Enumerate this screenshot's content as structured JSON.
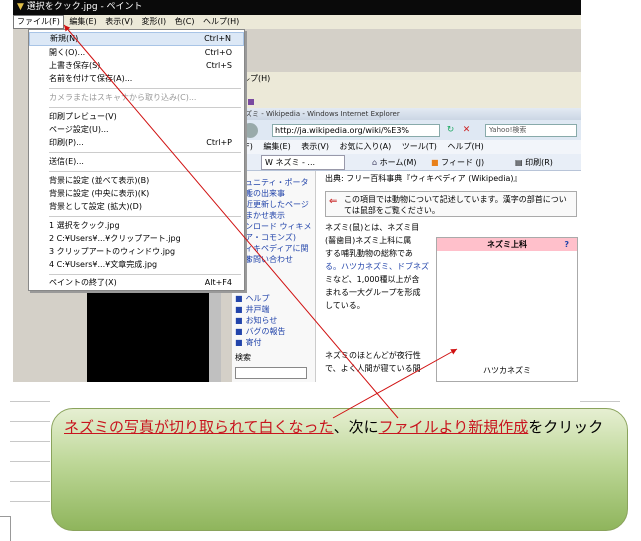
{
  "paint": {
    "title": "選択をクック.jpg - ペイント",
    "menu": [
      "ファイル(F)",
      "編集(E)",
      "表示(V)",
      "変形(I)",
      "色(C)",
      "ヘルプ(H)"
    ]
  },
  "background_window": {
    "menu_fragment": "ヘルプ(H)",
    "palette_colors": [
      "#6b2f8a",
      "#2c5ca8",
      "#7a4aa0",
      "#c8c8c8"
    ]
  },
  "file_menu": {
    "items": [
      {
        "label": "新規(N)",
        "shortcut": "Ctrl+N",
        "highlighted": true
      },
      {
        "label": "開く(O)...",
        "shortcut": "Ctrl+O"
      },
      {
        "label": "上書き保存(S)",
        "shortcut": "Ctrl+S"
      },
      {
        "label": "名前を付けて保存(A)..."
      },
      {
        "label": "カメラまたはスキャナから取り込み(C)...",
        "disabled": true
      },
      {
        "label": "印刷プレビュー(V)"
      },
      {
        "label": "ページ設定(U)..."
      },
      {
        "label": "印刷(P)...",
        "shortcut": "Ctrl+P"
      },
      {
        "label": "送信(E)..."
      },
      {
        "label": "背景に設定 (並べて表示)(B)"
      },
      {
        "label": "背景に設定 (中央に表示)(K)"
      },
      {
        "label": "背景として設定 (拡大)(D)"
      },
      {
        "label": "1 選択をクック.jpg"
      },
      {
        "label": "2 C:¥Users¥...¥クリップアート.jpg"
      },
      {
        "label": "3 クリップアートのウィンドウ.jpg"
      },
      {
        "label": "4 C:¥Users¥...¥文章完成.jpg"
      },
      {
        "label": "ペイントの終了(X)",
        "shortcut": "Alt+F4"
      }
    ]
  },
  "ie": {
    "title": "ネズミ - Wikipedia - Windows Internet Explorer",
    "url": "http://ja.wikipedia.org/wiki/%E3%",
    "search_placeholder": "Yahoo!検索",
    "menu": [
      "ル(F)",
      "編集(E)",
      "表示(V)",
      "お気に入り(A)",
      "ツール(T)",
      "ヘルプ(H)"
    ],
    "tab_label": "W ネズミ - ...",
    "toolbar": {
      "home": "ホーム(M)",
      "feed": "フィード (J)",
      "print": "印刷(R)"
    },
    "sidebar_partial": [
      "ュニティ・ポータル",
      "近の出来事",
      "近更新したページ",
      "まかせ表示",
      "ンロード ウィキメ",
      "ア・コモンズ)",
      "ィキペディアに関す",
      "お問い合わせ"
    ],
    "sidebar_links": [
      "ヘルプ",
      "井戸端",
      "お知らせ",
      "バグの報告",
      "寄付"
    ],
    "search_label": "検索",
    "source": "出典: フリー百科事典『ウィキペディア (Wikipedia)』",
    "notice": "この項目では動物について記述しています。漢字の部首については鼠部をご覧ください。",
    "para1": [
      "ネズミ(鼠)とは、ネズミ目",
      "(齧歯目)ネズミ上科に属",
      "する哺乳動物の総称であ",
      "る。ハツカネズミ、ドブネズ",
      "ミなど、1,000種以上が含",
      "まれる一大グループを形成",
      "している。"
    ],
    "para2": [
      "ネズミのほとんどが夜行性",
      "で、よく人間が寝ている間"
    ],
    "infobox_title": "ネズミ上科",
    "infobox_help": "?",
    "infobox_caption": "ハツカネズミ"
  },
  "callout": {
    "part1": "ネズミの写真が切り取られて白くなった",
    "part2": "、次に",
    "part3": "ファイルより新規作成",
    "part4": "をクリック"
  },
  "colors": {
    "callout_red": "#c8141e",
    "callout_green": "#8fb55c",
    "arrow_red": "#d01010"
  }
}
